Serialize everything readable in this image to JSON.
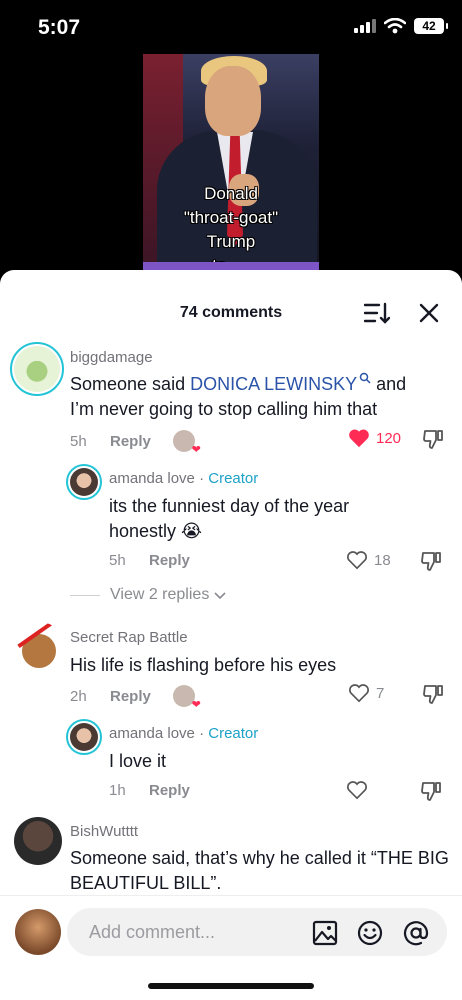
{
  "status_bar": {
    "time": "5:07",
    "battery": "42"
  },
  "video": {
    "caption_lines": [
      "Donald",
      "\"throat-goat\"",
      "Trump",
      "to ...."
    ]
  },
  "header": {
    "comment_count": "74 comments"
  },
  "comments": [
    {
      "username": "biggdamage",
      "text_before": "Someone said ",
      "link_text": "DONICA LEWINSKY",
      "text_after": " and I’m never going to stop calling him that",
      "time": "5h",
      "reply_label": "Reply",
      "likes": "120",
      "liked": true
    },
    {
      "username": "amanda love",
      "badge": "Creator",
      "separator": " · ",
      "text": "its the funniest day of the year honestly 😭",
      "time": "5h",
      "reply_label": "Reply",
      "likes": "18"
    },
    {
      "username": "Secret Rap Battle",
      "text": "His life is flashing before his eyes",
      "time": "2h",
      "reply_label": "Reply",
      "likes": "7"
    },
    {
      "username": "amanda love",
      "badge": "Creator",
      "separator": " · ",
      "text": "I love it",
      "time": "1h",
      "reply_label": "Reply",
      "likes": ""
    },
    {
      "username": "BishWutttt",
      "text": "Someone said, that’s why he called it “THE BIG BEAUTIFUL BILL”."
    }
  ],
  "view_replies": "View 2 replies",
  "composer": {
    "placeholder": "Add comment..."
  },
  "colors": {
    "accent_red": "#fe2c55",
    "creator_blue": "#1ea2c7",
    "link_blue": "#2b53a8"
  },
  "icons": [
    "signal-icon",
    "wifi-icon",
    "battery-icon",
    "sort-icon",
    "close-icon",
    "heart-icon",
    "dislike-icon",
    "search-small-icon",
    "image-icon",
    "emoji-icon",
    "mention-icon",
    "chevron-down-icon"
  ]
}
